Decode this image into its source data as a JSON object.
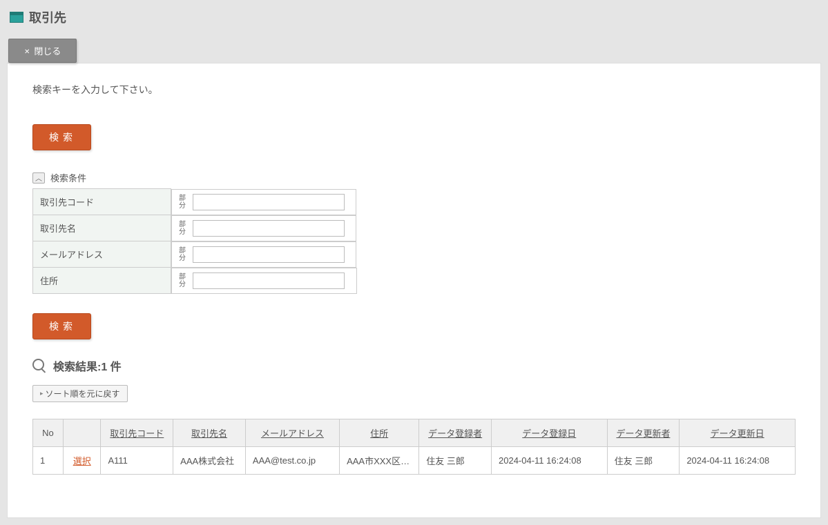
{
  "page": {
    "title": "取引先"
  },
  "buttons": {
    "close": "閉じる",
    "search": "検索",
    "reset_sort": "ソート順を元に戻す"
  },
  "instruction": "検索キーを入力して下さい。",
  "search_section": {
    "label": "検索条件",
    "fields": [
      {
        "label": "取引先コード",
        "match": "部分"
      },
      {
        "label": "取引先名",
        "match": "部分"
      },
      {
        "label": "メールアドレス",
        "match": "部分"
      },
      {
        "label": "住所",
        "match": "部分"
      }
    ]
  },
  "results": {
    "title": "検索結果:1 件",
    "headers": {
      "no": "No",
      "select": "",
      "code": "取引先コード",
      "name": "取引先名",
      "email": "メールアドレス",
      "address": "住所",
      "reg_user": "データ登録者",
      "reg_date": "データ登録日",
      "upd_user": "データ更新者",
      "upd_date": "データ更新日"
    },
    "rows": [
      {
        "no": "1",
        "select": "選択",
        "code": "A111",
        "name": "AAA株式会社",
        "email": "AAA@test.co.jp",
        "address": "AAA市XXX区…",
        "reg_user": "住友 三郎",
        "reg_date": "2024-04-11 16:24:08",
        "upd_user": "住友 三郎",
        "upd_date": "2024-04-11 16:24:08"
      }
    ]
  }
}
